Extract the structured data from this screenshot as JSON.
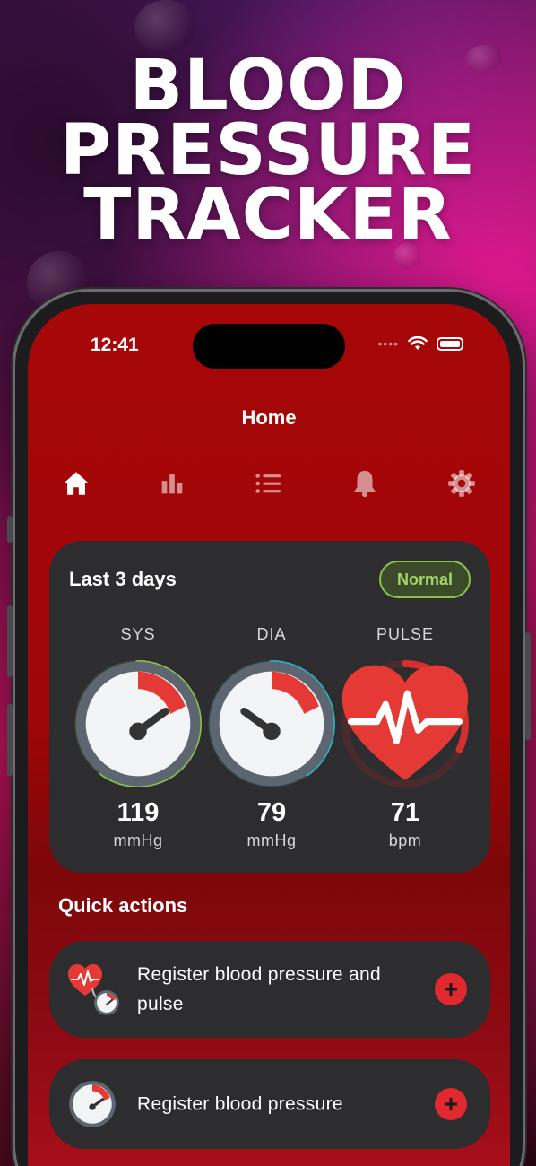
{
  "hero": {
    "line1": "BLOOD",
    "line2": "PRESSURE",
    "line3": "TRACKER"
  },
  "status_bar": {
    "time": "12:41",
    "signal": "••••"
  },
  "header": {
    "title": "Home"
  },
  "nav": {
    "items": [
      {
        "icon": "home-icon",
        "active": true
      },
      {
        "icon": "bar-chart-icon",
        "active": false
      },
      {
        "icon": "list-icon",
        "active": false
      },
      {
        "icon": "bell-icon",
        "active": false
      },
      {
        "icon": "gear-icon",
        "active": false
      }
    ]
  },
  "summary": {
    "title": "Last 3 days",
    "status_badge": "Normal",
    "metrics": [
      {
        "label": "SYS",
        "value": "119",
        "unit": "mmHg",
        "ring_fraction": 0.6,
        "color": "#8bc34a"
      },
      {
        "label": "DIA",
        "value": "79",
        "unit": "mmHg",
        "ring_fraction": 0.4,
        "color": "#2bb3c8"
      },
      {
        "label": "PULSE",
        "value": "71",
        "unit": "bpm",
        "ring_fraction": 0.32,
        "color": "#d32f2f"
      }
    ]
  },
  "quick_actions": {
    "title": "Quick actions",
    "items": [
      {
        "label": "Register blood pressure and pulse",
        "icon": "heart-gauge-icon"
      },
      {
        "label": "Register blood pressure",
        "icon": "gauge-icon"
      }
    ]
  },
  "colors": {
    "accent": "#e0282e",
    "background": "#a60708",
    "card": "#2d2d2f",
    "normal": "#8bc34a"
  }
}
